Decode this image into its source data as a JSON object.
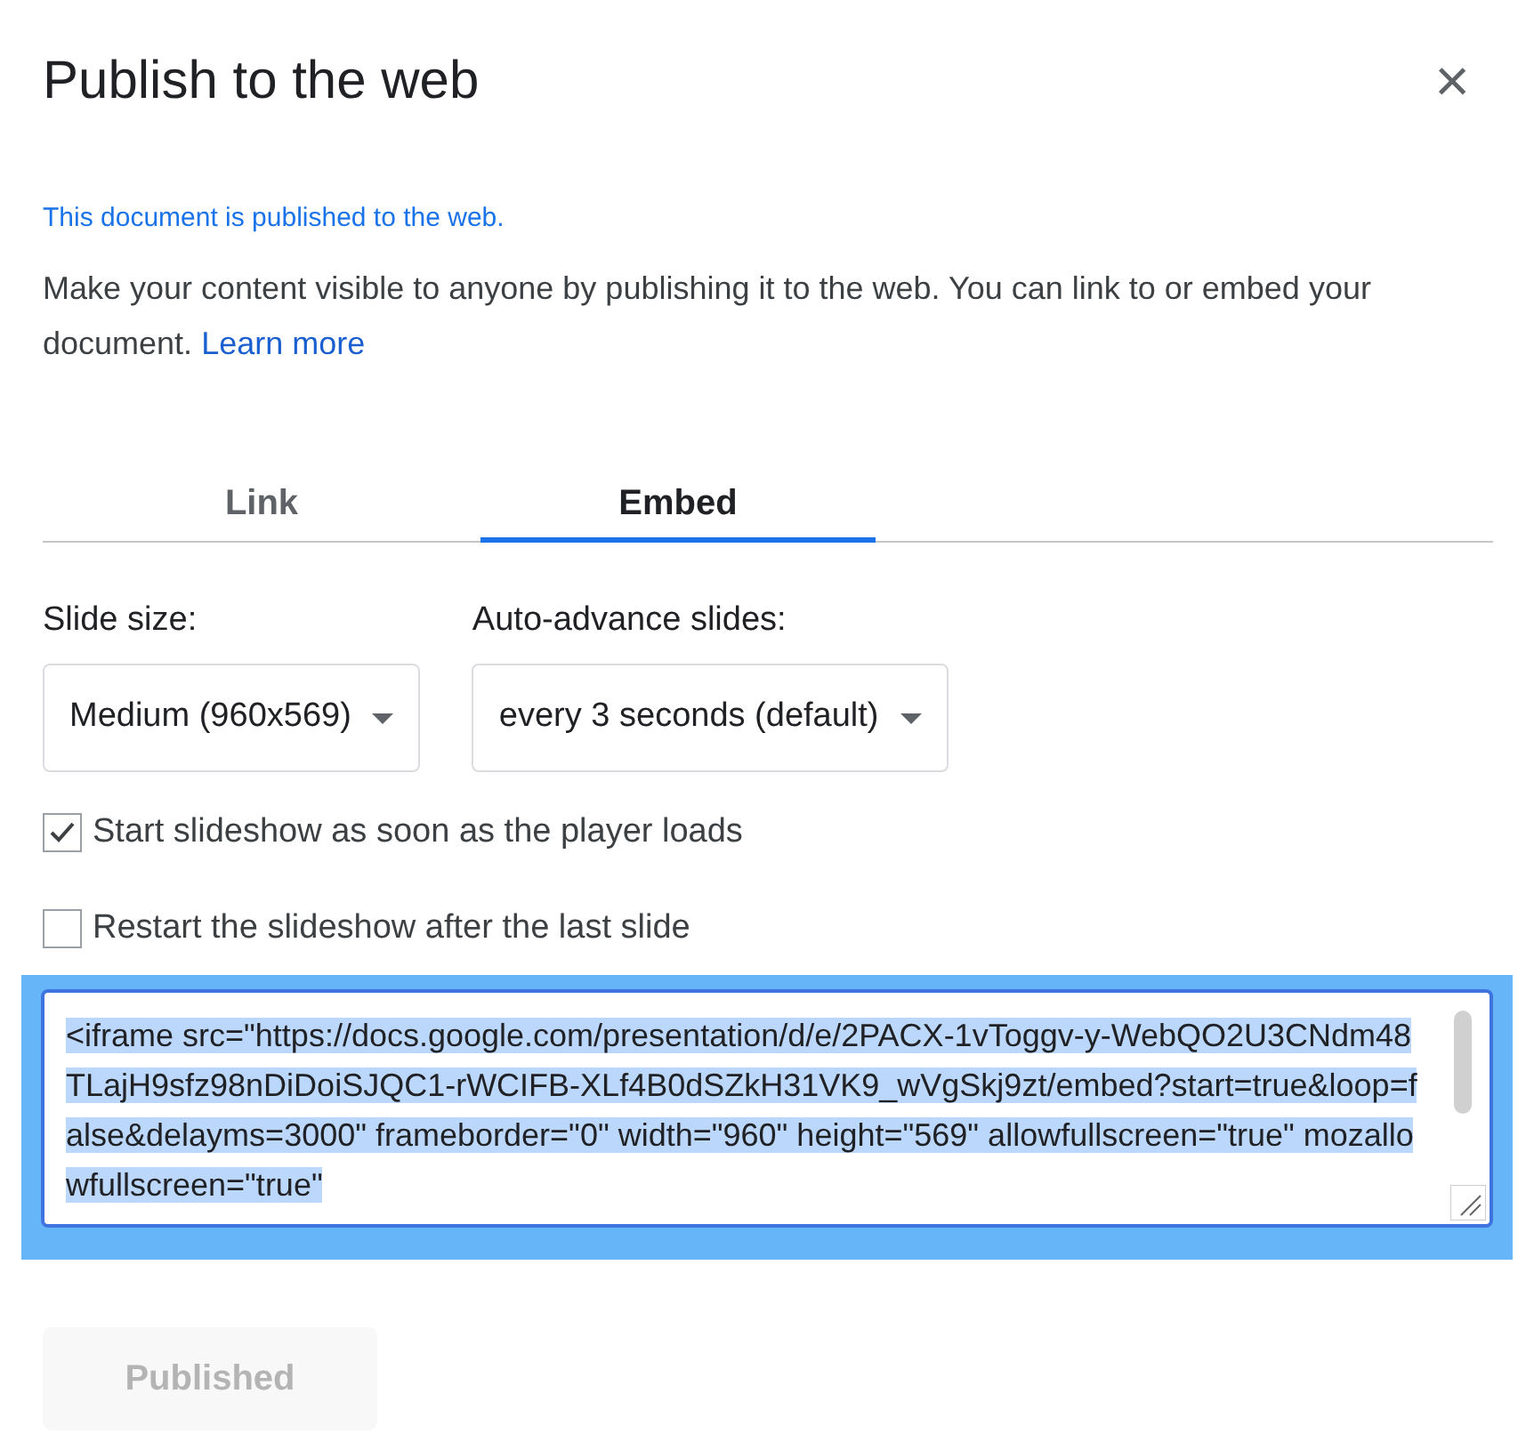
{
  "dialog": {
    "title": "Publish to the web",
    "close": "×"
  },
  "status": "This document is published to the web.",
  "description": {
    "text": "Make your content visible to anyone by publishing it to the web. You can link to or embed your document.",
    "link": "Learn more"
  },
  "tabs": [
    {
      "label": "Link",
      "selected": false
    },
    {
      "label": "Embed",
      "selected": true
    }
  ],
  "selects": [
    {
      "label": "Slide size:",
      "value": "Medium (960x569)"
    },
    {
      "label": "Auto-advance slides:",
      "value": "every 3 seconds (default)"
    }
  ],
  "options": [
    {
      "label": "Start slideshow as soon as the player loads",
      "checked": true
    },
    {
      "label": "Restart the slideshow after the last slide",
      "checked": false
    }
  ],
  "embed_code": {
    "value": "<iframe src=\"https://docs.google.com/presentation/d/e/2PACX-1vToggv-y-WebQO2U3CNdm48TLajH9sfz98nDiDoiSJQC1-rWCIFB-XLf4B0dSZkH31VK9_wVgSkj9zt/embed?start=true&loop=false&delayms=3000\" frameborder=\"0\" width=\"960\" height=\"569\" allowfullscreen=\"true\" mozallowfullscreen=\"true\"",
    "selected": true
  },
  "publish_button": {
    "label": "Published",
    "disabled": true
  }
}
